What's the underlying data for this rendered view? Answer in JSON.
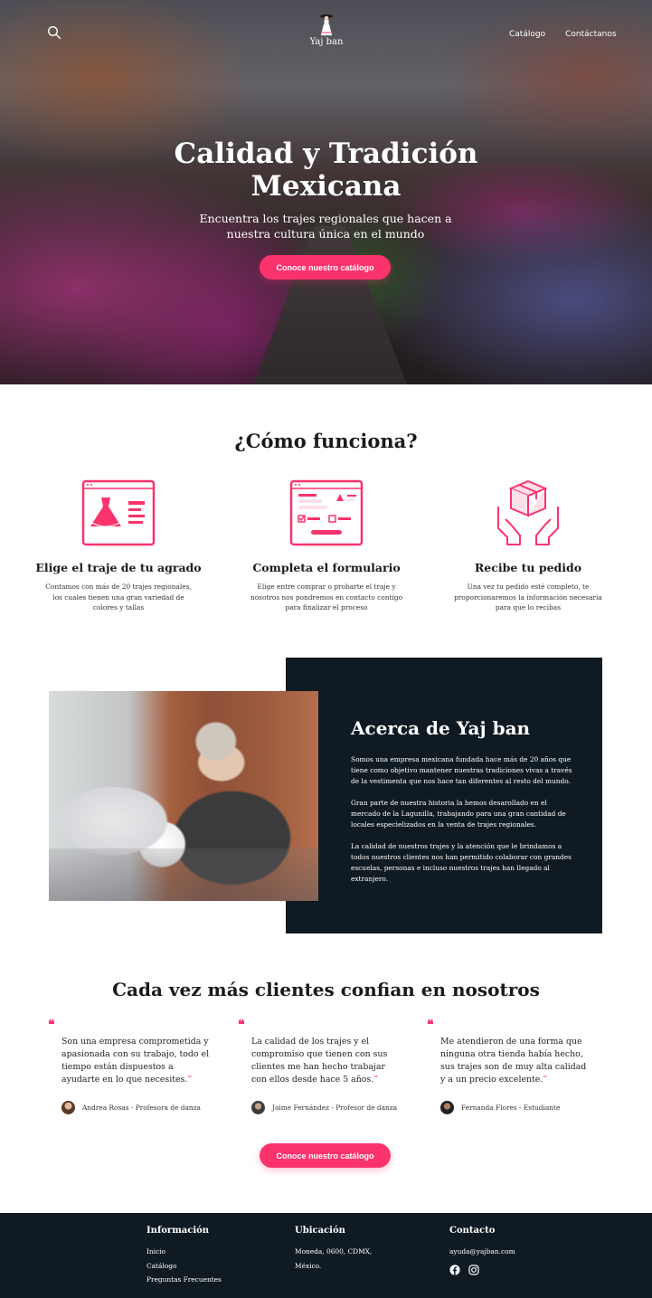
{
  "header": {
    "logo_text": "Yaj ban",
    "nav": [
      "Catálogo",
      "Contáctanos"
    ]
  },
  "hero": {
    "title_line1": "Calidad y Tradición",
    "title_line2": "Mexicana",
    "subtitle": "Encuentra los trajes regionales que hacen a nuestra cultura única en el mundo",
    "cta": "Conoce nuestro catálogo"
  },
  "how": {
    "title": "¿Cómo funciona?",
    "steps": [
      {
        "title": "Elige el traje de tu agrado",
        "text": "Contamos con más de 20 trajes regionales, los cuales tienen una gran variedad de colores y tallas"
      },
      {
        "title": "Completa el formulario",
        "text": "Elige entre comprar o probarte el traje y nosotros nos pondremos en contacto contigo para finalizar el proceso"
      },
      {
        "title": "Recibe tu pedido",
        "text": "Una vez tu pedido esté completo, te proporcionaremos la información necesaria para que lo recibas"
      }
    ]
  },
  "about": {
    "title": "Acerca de Yaj ban",
    "paragraphs": [
      "Somos una empresa mexicana fundada hace más de 20 años que tiene como objetivo mantener nuestras tradiciones vivas a través de la vestimenta que nos hace tan diferentes al resto del mundo.",
      "Gran parte de nuestra historia la hemos desarollado en el mercado de la Lagunilla, trabajando para una gran cantidad de locales especielizados en la venta de trajes regionales.",
      "La calidad de nuestros trajes y la atención que le brindamos a todos nuestros clientes nos han permitido colaborar con grandes escuelas, personas e incluso nuestros trajes han llegado al extranjero."
    ]
  },
  "testimonials": {
    "title": "Cada vez más clientes confian en nosotros",
    "open_quote": "❝",
    "close_quote": "”",
    "items": [
      {
        "text": "Son una empresa comprometida y apasionada con su trabajo, todo el tiempo están dispuestos a ayudarte en lo que necesites.",
        "author": "Andrea Rosas - Profesora de danza"
      },
      {
        "text": "La calidad de los trajes y el compromiso que tienen con sus clientes me han hecho trabajar con ellos desde hace 5 años.",
        "author": "Jaime Fernández - Profesor de danza"
      },
      {
        "text": "Me atendieron de una forma que ninguna otra tienda había hecho, sus trajes son de muy alta calidad y a un precio excelente.",
        "author": "Fernanda Flores - Estudiante"
      }
    ],
    "cta": "Conoce nuestro catálogo"
  },
  "footer": {
    "info": {
      "title": "Información",
      "links": [
        "Inicio",
        "Catálogo",
        "Preguntas Frecuentes"
      ]
    },
    "location": {
      "title": "Ubicación",
      "lines": [
        "Moneda, 0600, CDMX,",
        "México."
      ]
    },
    "contact": {
      "title": "Contacto",
      "email": "ayuda@yajban.com"
    }
  },
  "colors": {
    "accent": "#fb336d",
    "dark": "#0f1a22"
  }
}
